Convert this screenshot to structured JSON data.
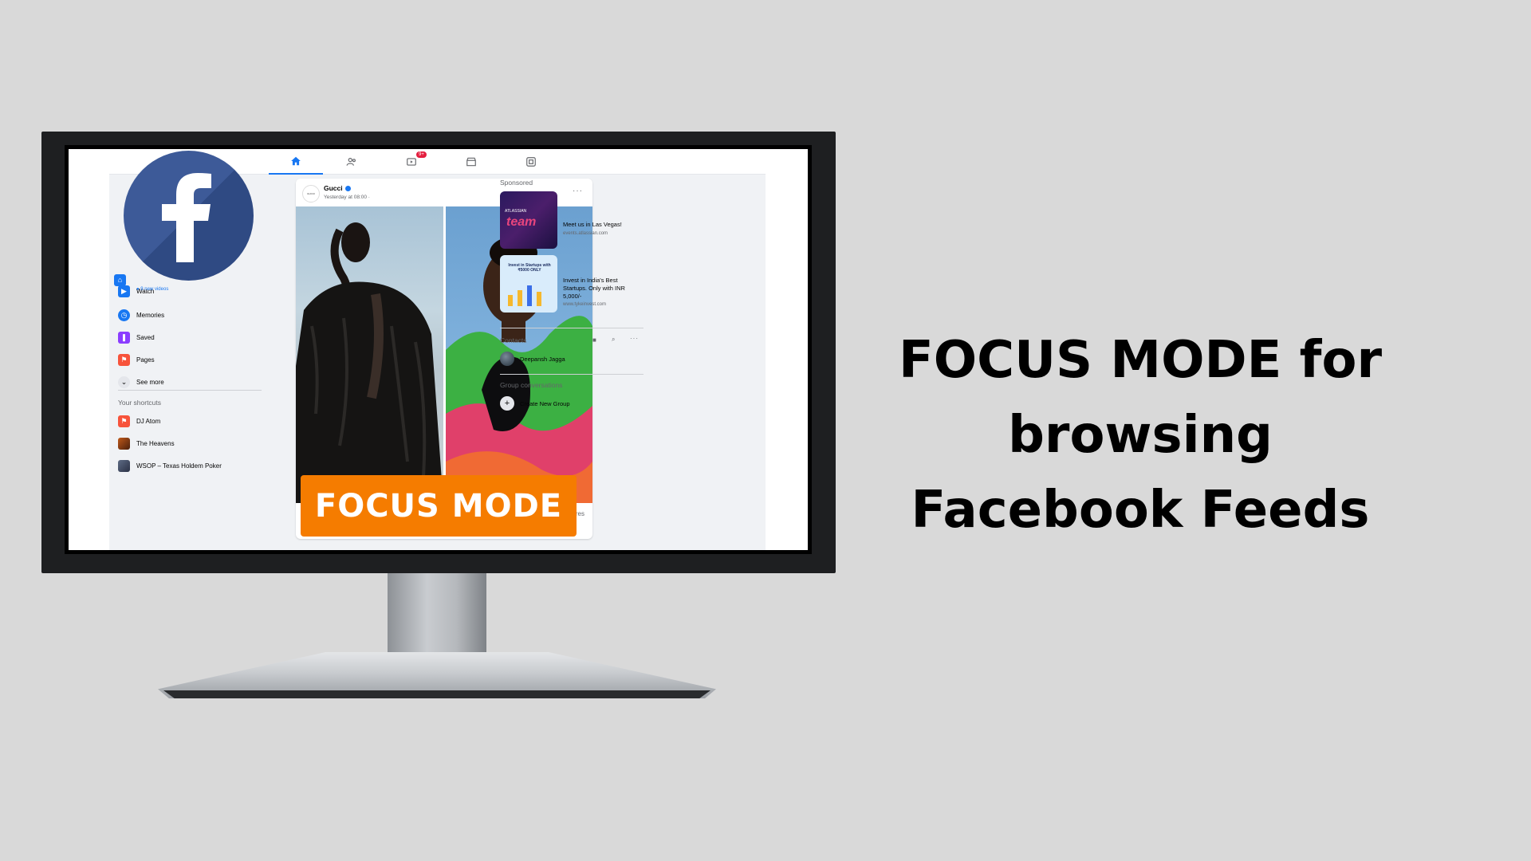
{
  "headline": {
    "line1": "FOCUS MODE for",
    "line2": "browsing",
    "line3": "Facebook Feeds"
  },
  "focus_button": {
    "label": "FOCUS MODE"
  },
  "facebook": {
    "logo_letter": "f",
    "nav": {
      "tabs": [
        "home-icon",
        "friends-icon",
        "watch-icon",
        "marketplace-icon",
        "gaming-icon"
      ],
      "watch_badge": "9+"
    },
    "left_menu": {
      "items": [
        {
          "label": "Watch",
          "sub": "9 new videos",
          "icon": "watch-icon",
          "color": "#1877f2"
        },
        {
          "label": "Memories",
          "icon": "clock-icon",
          "color": "#1877f2"
        },
        {
          "label": "Saved",
          "icon": "bookmark-icon",
          "color": "#8b3dff"
        },
        {
          "label": "Pages",
          "icon": "flag-icon",
          "color": "#f7533b"
        },
        {
          "label": "See more",
          "icon": "chevron-down-icon",
          "color": "#e4e6eb"
        }
      ],
      "shortcuts_title": "Your shortcuts",
      "shortcuts": [
        {
          "label": "DJ Atom"
        },
        {
          "label": "The Heavens"
        },
        {
          "label": "WSOP – Texas Holdem Poker"
        }
      ]
    },
    "post": {
      "author": "Gucci",
      "avatar_text": "GUCCI",
      "time": "Yesterday at 08:00 ·",
      "more": "···",
      "footer_partial": "res"
    },
    "right_column": {
      "sponsored_title": "Sponsored",
      "ads": [
        {
          "title": "Meet us in Las Vegas!",
          "url": "events.atlassian.com",
          "thumb_text": "team",
          "thumb_brand": "ATLASSIAN"
        },
        {
          "title": "Invest in India's Best Startups. Only with INR 5,000/-",
          "url": "www.tykeinvest.com",
          "thumb_text": "Invest in Startups with ₹5000 ONLY"
        }
      ],
      "contacts_title": "Contacts",
      "contacts": [
        {
          "name": "Deepansh Jagga"
        }
      ],
      "groups_title": "Group conversations",
      "create_group": "Create New Group"
    }
  }
}
